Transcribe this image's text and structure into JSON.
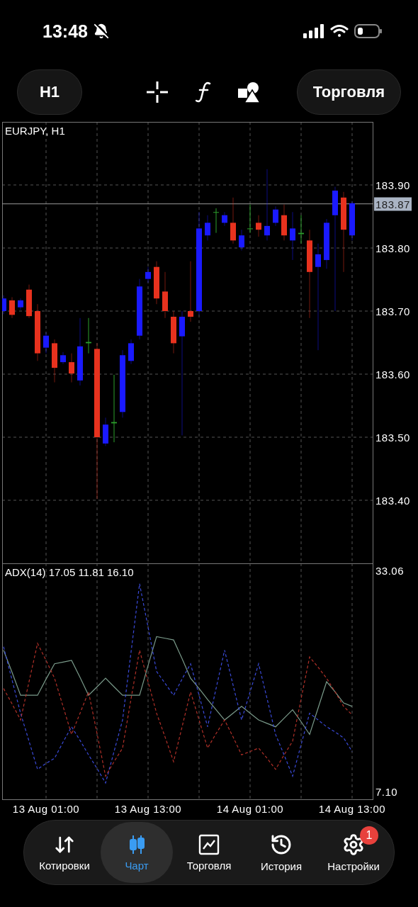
{
  "status_bar": {
    "time": "13:48"
  },
  "toolbar": {
    "timeframe": "H1",
    "trade_button": "Торговля"
  },
  "chart": {
    "title": "EURJPY, H1",
    "chart_data": {
      "type": "candlestick",
      "grid": true,
      "categories": [
        null,
        null,
        null,
        null,
        null,
        null,
        null,
        null,
        null,
        null,
        null,
        null,
        null,
        null,
        null,
        null,
        null,
        null,
        null,
        null,
        null,
        null,
        null,
        null,
        null,
        null,
        null,
        null,
        null,
        null,
        null,
        null,
        null,
        null,
        null,
        null,
        null,
        null,
        null,
        null,
        null,
        null
      ],
      "ohlc": [
        [
          183.7,
          183.725,
          183.695,
          183.72
        ],
        [
          183.717,
          183.722,
          183.689,
          183.694
        ],
        [
          183.706,
          183.72,
          183.702,
          183.717
        ],
        [
          183.734,
          183.742,
          183.689,
          183.692
        ],
        [
          183.7,
          183.711,
          183.621,
          183.633
        ],
        [
          183.642,
          183.666,
          183.633,
          183.661
        ],
        [
          183.649,
          183.655,
          183.587,
          183.61
        ],
        [
          183.619,
          183.635,
          183.616,
          183.63
        ],
        [
          183.619,
          183.633,
          183.587,
          183.601
        ],
        [
          183.59,
          183.689,
          183.582,
          183.644
        ],
        [
          183.649,
          183.689,
          183.633,
          183.651
        ],
        [
          183.64,
          183.649,
          183.402,
          183.5
        ],
        [
          183.49,
          183.531,
          183.486,
          183.52
        ],
        [
          183.522,
          183.599,
          183.492,
          183.524
        ],
        [
          183.54,
          183.638,
          183.531,
          183.63
        ],
        [
          183.621,
          183.655,
          183.616,
          183.649
        ],
        [
          183.661,
          183.751,
          183.655,
          183.739
        ],
        [
          183.751,
          183.77,
          183.745,
          183.762
        ],
        [
          183.77,
          183.779,
          183.711,
          183.72
        ],
        [
          183.731,
          183.762,
          183.689,
          183.7
        ],
        [
          183.691,
          183.7,
          183.633,
          183.649
        ],
        [
          183.66,
          183.7,
          183.503,
          183.691
        ],
        [
          183.7,
          183.779,
          183.683,
          183.691
        ],
        [
          183.7,
          183.857,
          183.694,
          183.831
        ],
        [
          183.82,
          183.852,
          183.812,
          183.84
        ],
        [
          183.856,
          183.863,
          183.824,
          183.857
        ],
        [
          183.84,
          183.857,
          183.835,
          183.852
        ],
        [
          183.84,
          183.88,
          183.807,
          183.812
        ],
        [
          183.801,
          183.829,
          183.796,
          183.82
        ],
        [
          183.83,
          183.869,
          183.824,
          183.831
        ],
        [
          183.84,
          183.852,
          183.818,
          183.829
        ],
        [
          183.82,
          183.925,
          183.812,
          183.835
        ],
        [
          183.84,
          183.866,
          183.835,
          183.861
        ],
        [
          183.852,
          183.869,
          183.812,
          183.82
        ],
        [
          183.812,
          183.857,
          183.781,
          183.831
        ],
        [
          183.822,
          183.852,
          183.807,
          183.824
        ],
        [
          183.812,
          183.829,
          183.689,
          183.762
        ],
        [
          183.77,
          183.807,
          183.638,
          183.79
        ],
        [
          183.781,
          183.846,
          183.767,
          183.84
        ],
        [
          183.852,
          183.897,
          183.7,
          183.891
        ],
        [
          183.88,
          183.889,
          183.762,
          183.829
        ],
        [
          183.82,
          183.874,
          183.812,
          183.871
        ]
      ],
      "ylim": [
        183.3,
        184.0
      ],
      "yticks": [
        {
          "value": 183.9,
          "label": "183.90"
        },
        {
          "value": 183.8,
          "label": "183.80"
        },
        {
          "value": 183.7,
          "label": "183.70"
        },
        {
          "value": 183.6,
          "label": "183.60"
        },
        {
          "value": 183.5,
          "label": "183.50"
        },
        {
          "value": 183.4,
          "label": "183.40"
        }
      ],
      "ref_lines": [
        {
          "axis": "y",
          "value": 183.87,
          "label": "183.87"
        }
      ]
    },
    "indicator": {
      "label": "ADX(14) 17.05 11.81 16.10",
      "chart_data": {
        "type": "line",
        "grid": true,
        "categories": [
          null,
          null,
          null,
          null,
          null,
          "13 Aug 01:00",
          null,
          null,
          null,
          null,
          null,
          null,
          null,
          null,
          null,
          null,
          null,
          "13 Aug 13:00",
          null,
          null,
          null,
          null,
          null,
          null,
          null,
          null,
          null,
          null,
          null,
          "14 Aug 01:00",
          null,
          null,
          null,
          null,
          null,
          null,
          null,
          null,
          null,
          null,
          null,
          "14 Aug 13:00"
        ],
        "series": [
          {
            "color": "#7a9a8a",
            "line_style": "solid",
            "values": [
              23.7,
              21.1,
              18.4,
              18.4,
              18.4,
              20.3,
              22.1,
              22.3,
              22.5,
              20.5,
              18.4,
              19.4,
              20.4,
              19.4,
              18.4,
              18.4,
              18.4,
              21.9,
              25.3,
              25.1,
              24.9,
              22.7,
              20.4,
              19.2,
              17.9,
              16.7,
              15.5,
              16.3,
              17.1,
              16.3,
              15.5,
              15.1,
              14.7,
              15.7,
              16.7,
              15.3,
              13.8,
              16.9,
              20.0,
              18.8,
              17.5,
              17.1
            ]
          },
          {
            "color": "#3a4ad8",
            "line_style": "dashed",
            "values": [
              24.1,
              20.2,
              16.3,
              13.0,
              9.7,
              10.4,
              11.0,
              12.9,
              14.7,
              13.1,
              11.4,
              9.8,
              8.1,
              11.8,
              15.5,
              23.5,
              31.5,
              26.4,
              21.2,
              19.8,
              18.4,
              20.3,
              22.1,
              18.4,
              14.7,
              19.2,
              23.7,
              19.6,
              15.5,
              18.8,
              22.1,
              18.0,
              13.8,
              11.4,
              8.9,
              12.6,
              16.3,
              15.5,
              14.7,
              14.1,
              13.4,
              11.8
            ]
          },
          {
            "color": "#b03028",
            "line_style": "dashed",
            "values": [
              19.2,
              17.4,
              15.5,
              20.0,
              24.5,
              22.5,
              20.4,
              17.1,
              13.8,
              16.3,
              18.8,
              13.9,
              8.9,
              10.6,
              12.2,
              18.0,
              23.7,
              20.0,
              16.3,
              13.5,
              10.6,
              14.7,
              18.8,
              15.5,
              12.2,
              13.9,
              15.5,
              13.5,
              11.4,
              11.8,
              12.2,
              11.0,
              9.7,
              11.4,
              13.0,
              18.0,
              22.9,
              21.7,
              20.4,
              18.8,
              17.1,
              16.1
            ]
          }
        ],
        "ylim": [
          6.1,
          33.9
        ],
        "yticks": [
          {
            "value": 33.06,
            "label": "33.06"
          },
          {
            "value": 7.1,
            "label": "7.10"
          }
        ]
      }
    }
  },
  "nav": [
    {
      "kind": "quotes",
      "label": "Котировки",
      "selected": false
    },
    {
      "kind": "chart",
      "label": "Чарт",
      "selected": true
    },
    {
      "kind": "trade",
      "label": "Торговля",
      "selected": false
    },
    {
      "kind": "history",
      "label": "История",
      "selected": false
    },
    {
      "kind": "settings",
      "label": "Настройки",
      "selected": false,
      "badge": "1"
    }
  ]
}
